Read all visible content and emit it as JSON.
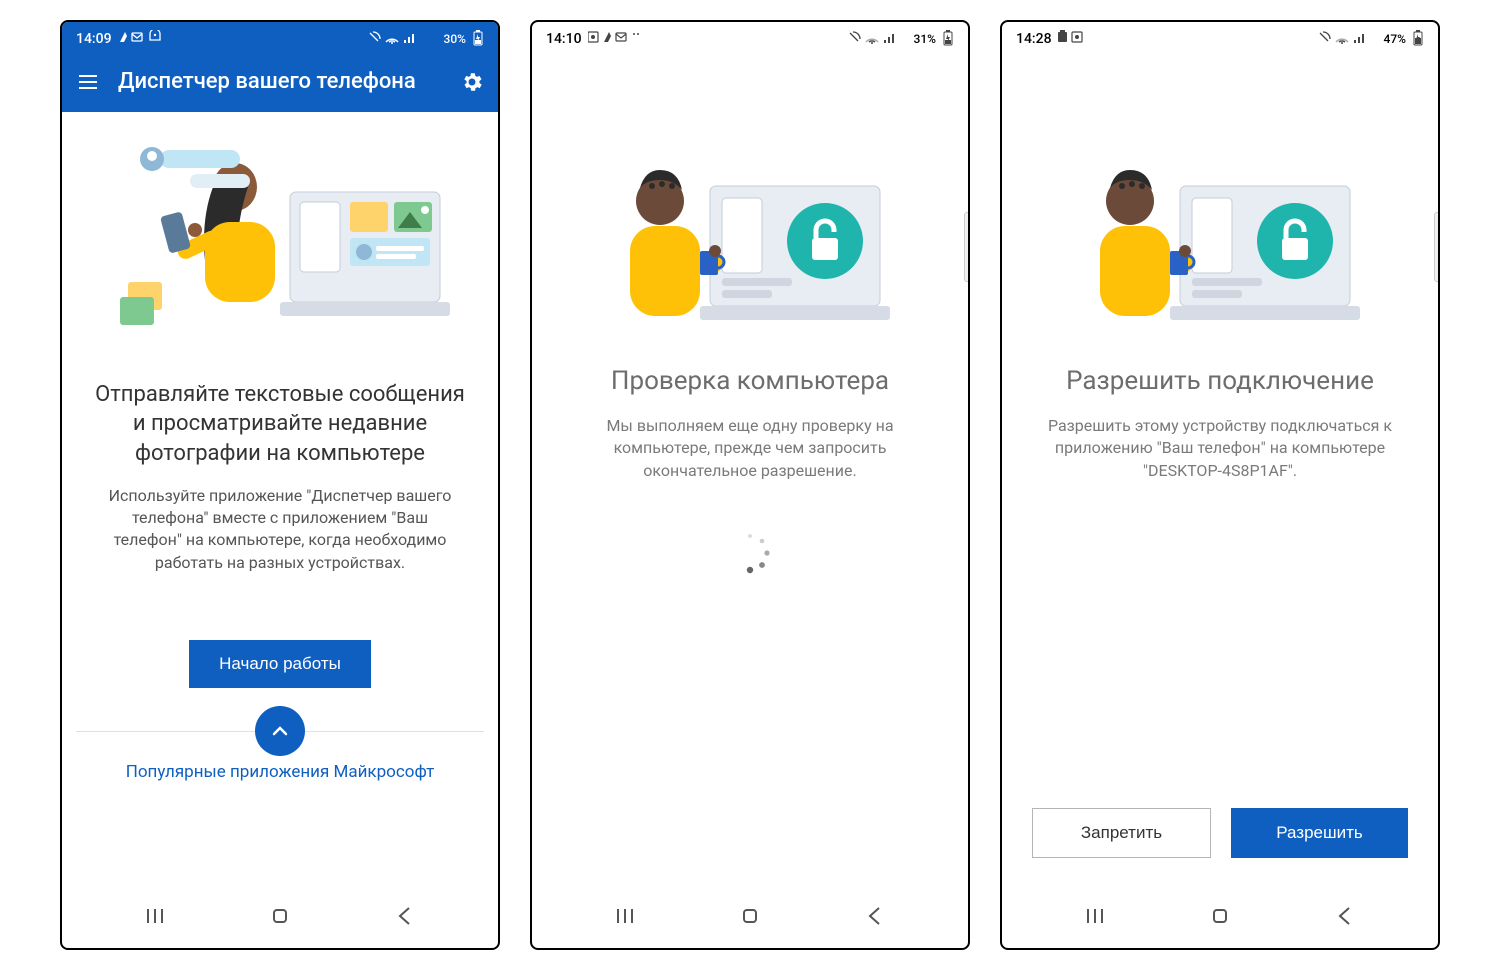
{
  "screens": {
    "s1": {
      "time": "14:09",
      "battery": "30%",
      "app_title": "Диспетчер вашего телефона",
      "headline": "Отправляйте текстовые сообщения и просматривайте недавние фотографии на компьютере",
      "body": "Используйте приложение \"Диспетчер вашего телефона\" вместе с приложением \"Ваш телефон\" на компьютере, когда необходимо работать на разных устройствах.",
      "primary_btn": "Начало работы",
      "bottom_link": "Популярные приложения Майкрософт"
    },
    "s2": {
      "time": "14:10",
      "battery": "31%",
      "headline": "Проверка компьютера",
      "body": "Мы выполняем еще одну проверку на компьютере, прежде чем запросить окончательное разрешение."
    },
    "s3": {
      "time": "14:28",
      "battery": "47%",
      "headline": "Разрешить подключение",
      "body": "Разрешить этому устройству подключаться к приложению \"Ваш телефон\" на компьютере \"DESKTOP-4S8P1AF\".",
      "deny_btn": "Запретить",
      "allow_btn": "Разрешить"
    }
  }
}
